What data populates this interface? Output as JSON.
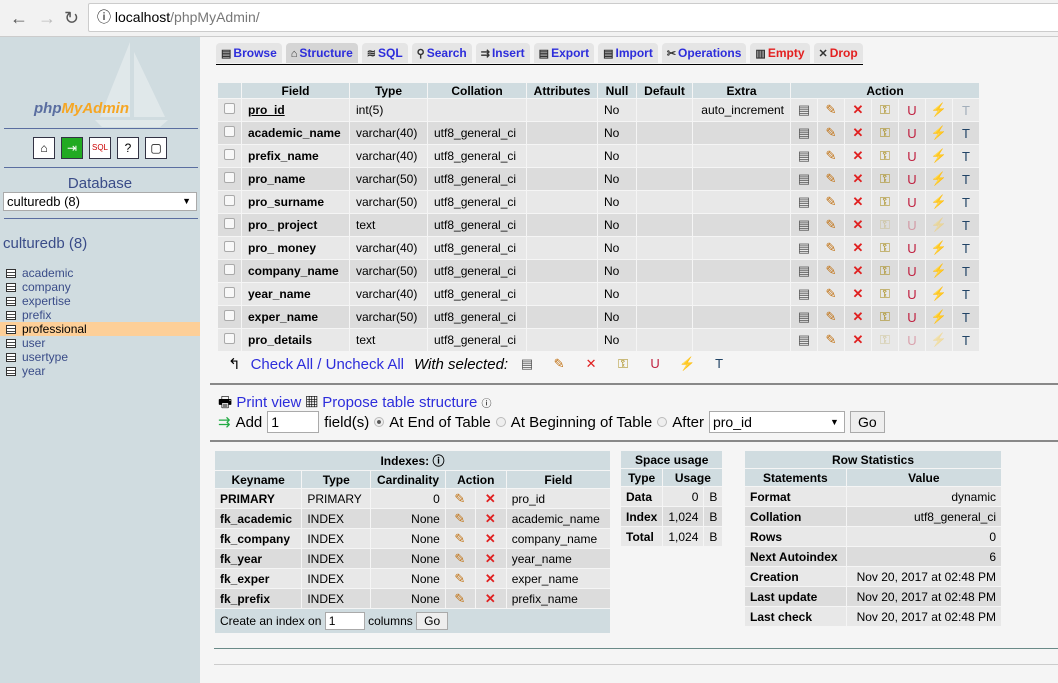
{
  "browser": {
    "host": "localhost",
    "path": "/phpMyAdmin/"
  },
  "sidebar": {
    "logo_php": "php",
    "logo_rest": "MyAdmin",
    "database_label": "Database",
    "database_select": "culturedb (8)",
    "db_title": "culturedb (8)",
    "tables": [
      "academic",
      "company",
      "expertise",
      "prefix",
      "professional",
      "user",
      "usertype",
      "year"
    ],
    "selected_table": "professional"
  },
  "tabs": [
    {
      "label": "Browse",
      "icon": "browse-icon"
    },
    {
      "label": "Structure",
      "icon": "structure-icon",
      "active": true
    },
    {
      "label": "SQL",
      "icon": "sql-icon"
    },
    {
      "label": "Search",
      "icon": "search-icon"
    },
    {
      "label": "Insert",
      "icon": "insert-icon"
    },
    {
      "label": "Export",
      "icon": "export-icon"
    },
    {
      "label": "Import",
      "icon": "import-icon"
    },
    {
      "label": "Operations",
      "icon": "operations-icon"
    },
    {
      "label": "Empty",
      "icon": "empty-icon",
      "red": true
    },
    {
      "label": "Drop",
      "icon": "drop-icon",
      "red": true
    }
  ],
  "structure": {
    "headers": [
      "Field",
      "Type",
      "Collation",
      "Attributes",
      "Null",
      "Default",
      "Extra",
      "Action"
    ],
    "rows": [
      {
        "field": "pro_id",
        "type": "int(5)",
        "collation": "",
        "attributes": "",
        "null": "No",
        "default": "",
        "extra": "auto_increment",
        "primary": true,
        "disabled": [
          6
        ]
      },
      {
        "field": "academic_name",
        "type": "varchar(40)",
        "collation": "utf8_general_ci",
        "attributes": "",
        "null": "No",
        "default": "",
        "extra": "",
        "disabled": []
      },
      {
        "field": "prefix_name",
        "type": "varchar(40)",
        "collation": "utf8_general_ci",
        "attributes": "",
        "null": "No",
        "default": "",
        "extra": "",
        "disabled": []
      },
      {
        "field": "pro_name",
        "type": "varchar(50)",
        "collation": "utf8_general_ci",
        "attributes": "",
        "null": "No",
        "default": "",
        "extra": "",
        "disabled": []
      },
      {
        "field": "pro_surname",
        "type": "varchar(50)",
        "collation": "utf8_general_ci",
        "attributes": "",
        "null": "No",
        "default": "",
        "extra": "",
        "disabled": []
      },
      {
        "field": "pro_ project",
        "type": "text",
        "collation": "utf8_general_ci",
        "attributes": "",
        "null": "No",
        "default": "",
        "extra": "",
        "disabled": [
          3,
          4,
          5
        ]
      },
      {
        "field": "pro_ money",
        "type": "varchar(40)",
        "collation": "utf8_general_ci",
        "attributes": "",
        "null": "No",
        "default": "",
        "extra": "",
        "disabled": []
      },
      {
        "field": "company_name",
        "type": "varchar(50)",
        "collation": "utf8_general_ci",
        "attributes": "",
        "null": "No",
        "default": "",
        "extra": "",
        "disabled": []
      },
      {
        "field": "year_name",
        "type": "varchar(40)",
        "collation": "utf8_general_ci",
        "attributes": "",
        "null": "No",
        "default": "",
        "extra": "",
        "disabled": []
      },
      {
        "field": "exper_name",
        "type": "varchar(50)",
        "collation": "utf8_general_ci",
        "attributes": "",
        "null": "No",
        "default": "",
        "extra": "",
        "disabled": []
      },
      {
        "field": "pro_details",
        "type": "text",
        "collation": "utf8_general_ci",
        "attributes": "",
        "null": "No",
        "default": "",
        "extra": "",
        "disabled": [
          3,
          4,
          5
        ]
      }
    ],
    "check_all": "Check All",
    "slash": " / ",
    "uncheck_all": "Uncheck All",
    "with_selected": "With selected:"
  },
  "tools": {
    "print_view": "Print view",
    "propose": "Propose table structure",
    "add": "Add",
    "add_count": "1",
    "fields_label": "field(s)",
    "at_end": "At End of Table",
    "at_beginning": "At Beginning of Table",
    "after": "After",
    "after_select": "pro_id",
    "go": "Go"
  },
  "indexes": {
    "title": "Indexes:",
    "headers": [
      "Keyname",
      "Type",
      "Cardinality",
      "Action",
      "Field"
    ],
    "rows": [
      [
        "PRIMARY",
        "PRIMARY",
        "0",
        "pro_id"
      ],
      [
        "fk_academic",
        "INDEX",
        "None",
        "academic_name"
      ],
      [
        "fk_company",
        "INDEX",
        "None",
        "company_name"
      ],
      [
        "fk_year",
        "INDEX",
        "None",
        "year_name"
      ],
      [
        "fk_exper",
        "INDEX",
        "None",
        "exper_name"
      ],
      [
        "fk_prefix",
        "INDEX",
        "None",
        "prefix_name"
      ]
    ],
    "create_label": "Create an index on",
    "create_count": "1",
    "columns_label": "columns",
    "go": "Go"
  },
  "space": {
    "title": "Space usage",
    "headers": [
      "Type",
      "Usage"
    ],
    "rows": [
      [
        "Data",
        "0",
        "B"
      ],
      [
        "Index",
        "1,024",
        "B"
      ],
      [
        "Total",
        "1,024",
        "B"
      ]
    ]
  },
  "rowstats": {
    "title": "Row Statistics",
    "headers": [
      "Statements",
      "Value"
    ],
    "rows": [
      [
        "Format",
        "dynamic"
      ],
      [
        "Collation",
        "utf8_general_ci"
      ],
      [
        "Rows",
        "0"
      ],
      [
        "Next Autoindex",
        "6"
      ],
      [
        "Creation",
        "Nov 20, 2017 at 02:48 PM"
      ],
      [
        "Last update",
        "Nov 20, 2017 at 02:48 PM"
      ],
      [
        "Last check",
        "Nov 20, 2017 at 02:48 PM"
      ]
    ]
  }
}
